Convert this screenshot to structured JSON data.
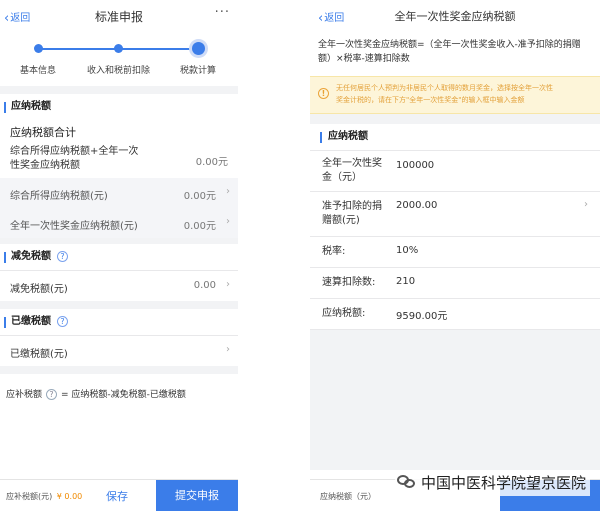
{
  "left": {
    "nav": {
      "back": "返回",
      "title": "标准申报",
      "more": "···"
    },
    "steps": [
      "基本信息",
      "收入和税前扣除",
      "税款计算"
    ],
    "taxable": {
      "heading": "应纳税额",
      "total_label": "应纳税额合计",
      "combined_label_1": "综合所得应纳税额+全年一次",
      "combined_label_2": "性奖金应纳税额",
      "combined_value": "0.00元",
      "comprehensive_label": "综合所得应纳税额(元)",
      "comprehensive_value": "0.00元",
      "bonus_label": "全年一次性奖金应纳税额(元)",
      "bonus_value": "0.00元"
    },
    "relief": {
      "heading": "减免税额",
      "label": "减免税额(元)",
      "value": "0.00"
    },
    "paid": {
      "heading": "已缴税额",
      "label": "已缴税额(元)"
    },
    "formula": {
      "prefix": "应补税额",
      "text": "= 应纳税额-减免税额-已缴税额"
    },
    "footer": {
      "label": "应补税额(元)",
      "amount": "¥ 0.00",
      "save": "保存",
      "submit": "提交申报"
    }
  },
  "right": {
    "nav": {
      "back": "返回",
      "title": "全年一次性奖金应纳税额"
    },
    "formula_1": "全年一次性奖金应纳税额=（全年一次性奖金收入-准予扣除的捐赠",
    "formula_2": "额）×税率-速算扣除数",
    "notice_1": "无任何居民个人预判为非居民个人取得的数月奖金，选择按全年一次性",
    "notice_2": "奖金计税的，请在下方\"全年一次性奖金\"的输入框中输入金额",
    "heading": "应纳税额",
    "rows": {
      "bonus_label_1": "全年一次性奖",
      "bonus_label_2": "金（元）",
      "bonus_value": "100000",
      "donation_label_1": "准予扣除的捐",
      "donation_label_2": "赠额(元)",
      "donation_value": "2000.00",
      "rate_label": "税率:",
      "rate_value": "10%",
      "quick_label": "速算扣除数:",
      "quick_value": "210",
      "tax_label": "应纳税额:",
      "tax_value": "9590.00元"
    },
    "footer": {
      "label": "应纳税额（元）"
    }
  },
  "watermark": "中国中医科学院望京医院",
  "colors": {
    "accent": "#3b7de9",
    "warning": "#e3a13a",
    "amount": "#f08a00"
  }
}
